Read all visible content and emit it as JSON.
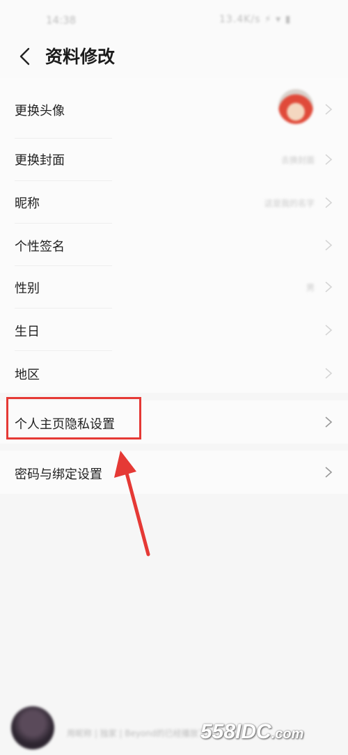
{
  "status_bar": {
    "time": "14:38",
    "icons": "13.4K/s ⚡ ▾ ▮"
  },
  "header": {
    "title": "资料修改"
  },
  "rows": [
    {
      "label": "更换头像",
      "value": ""
    },
    {
      "label": "更换封面",
      "value": "去换封面"
    },
    {
      "label": "昵称",
      "value": "这是我的名字"
    },
    {
      "label": "个性签名",
      "value": ""
    },
    {
      "label": "性别",
      "value": "男"
    },
    {
      "label": "生日",
      "value": ""
    },
    {
      "label": "地区",
      "value": ""
    }
  ],
  "privacy": {
    "label": "个人主页隐私设置"
  },
  "password": {
    "label": "密码与绑定设置"
  },
  "bottom": {
    "text": "用昵称 | 独家 | Beyond的已经播放了"
  },
  "watermark": {
    "main": "558IDC",
    "suffix": ".com"
  },
  "colors": {
    "highlight": "#e53935",
    "arrow": "#e53935"
  }
}
